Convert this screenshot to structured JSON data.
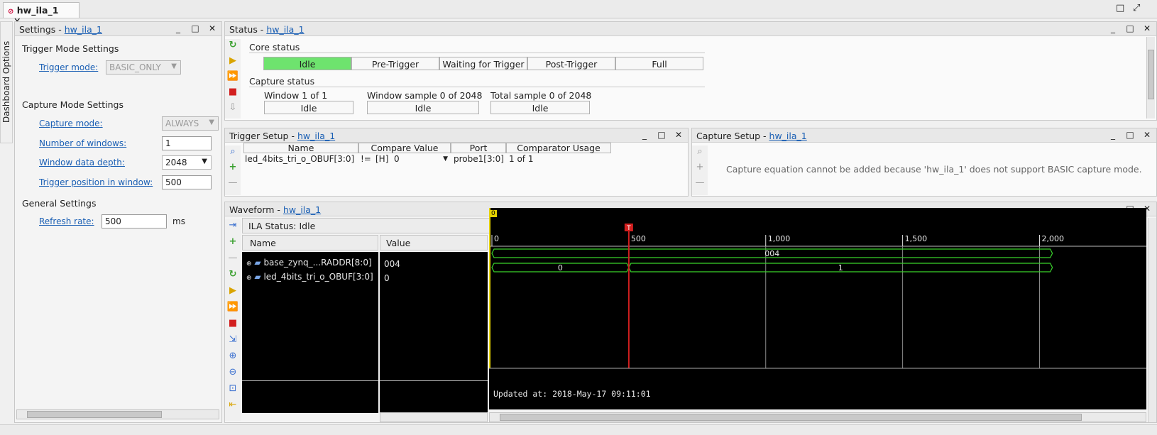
{
  "tab": {
    "title": "hw_ila_1",
    "close": "✕"
  },
  "window_buttons": [
    "□",
    "⤢"
  ],
  "left_strip": {
    "label": "Dashboard Options"
  },
  "settings": {
    "title": "Settings -",
    "link": "hw_ila_1",
    "trigger_section": "Trigger Mode Settings",
    "trigger_mode_label": "Trigger mode:",
    "trigger_mode_value": "BASIC_ONLY",
    "capture_section": "Capture Mode Settings",
    "capture_mode_label": "Capture mode:",
    "capture_mode_value": "ALWAYS",
    "num_windows_label": "Number of windows:",
    "num_windows_value": "1",
    "depth_label": "Window data depth:",
    "depth_value": "2048",
    "trigpos_label": "Trigger position in window:",
    "trigpos_value": "500",
    "general_section": "General Settings",
    "refresh_label": "Refresh rate:",
    "refresh_value": "500",
    "refresh_unit": "ms"
  },
  "status": {
    "title": "Status -",
    "link": "hw_ila_1",
    "core_status": "Core status",
    "states": [
      "Idle",
      "Pre-Trigger",
      "Waiting for Trigger",
      "Post-Trigger",
      "Full"
    ],
    "active_color": "#6ee36e",
    "capture_status": "Capture status",
    "window_label": "Window 1 of 1",
    "window_sample_label": "Window sample 0 of 2048",
    "total_sample_label": "Total sample 0 of 2048",
    "window_value": "Idle",
    "window_sample_value": "Idle",
    "total_sample_value": "Idle"
  },
  "trigger_setup": {
    "title": "Trigger Setup -",
    "link": "hw_ila_1",
    "headers": [
      "Name",
      "Compare Value",
      "Port",
      "Comparator Usage"
    ],
    "row": {
      "name": "led_4bits_tri_o_OBUF[3:0]",
      "op": "!=",
      "radix": "[H]",
      "value": "0",
      "port": "probe1[3:0]",
      "usage": "1 of 1"
    }
  },
  "capture_setup": {
    "title": "Capture Setup -",
    "link": "hw_ila_1",
    "message": "Capture equation cannot be added because 'hw_ila_1' does not support BASIC capture mode."
  },
  "waveform": {
    "title": "Waveform -",
    "link": "hw_ila_1",
    "ila_status": "ILA Status: Idle",
    "col_name": "Name",
    "col_value": "Value",
    "signals": [
      {
        "name": "base_zynq_...RADDR[8:0]",
        "value": "004"
      },
      {
        "name": "led_4bits_tri_o_OBUF[3:0]",
        "value": "0"
      }
    ],
    "marker_zero": "0",
    "trigger_marker": "T",
    "updated": "Updated at: 2018-May-17 09:11:01"
  },
  "chart_data": {
    "type": "waveform",
    "x_ticks": [
      "0",
      "500",
      "1,000",
      "1,500",
      "2,000"
    ],
    "x_range": [
      0,
      2048
    ],
    "trigger_at": 500,
    "buses": [
      {
        "name": "base_zynq_...RADDR[8:0]",
        "segments": [
          {
            "from": 0,
            "to": 2047,
            "label": "004"
          }
        ]
      },
      {
        "name": "led_4bits_tri_o_OBUF[3:0]",
        "segments": [
          {
            "from": 0,
            "to": 500,
            "label": "0"
          },
          {
            "from": 500,
            "to": 2047,
            "label": "1"
          }
        ]
      }
    ],
    "wave_color": "#39d22b",
    "trigger_color": "#d21f1f",
    "grid_color": "#8a8a8a"
  }
}
